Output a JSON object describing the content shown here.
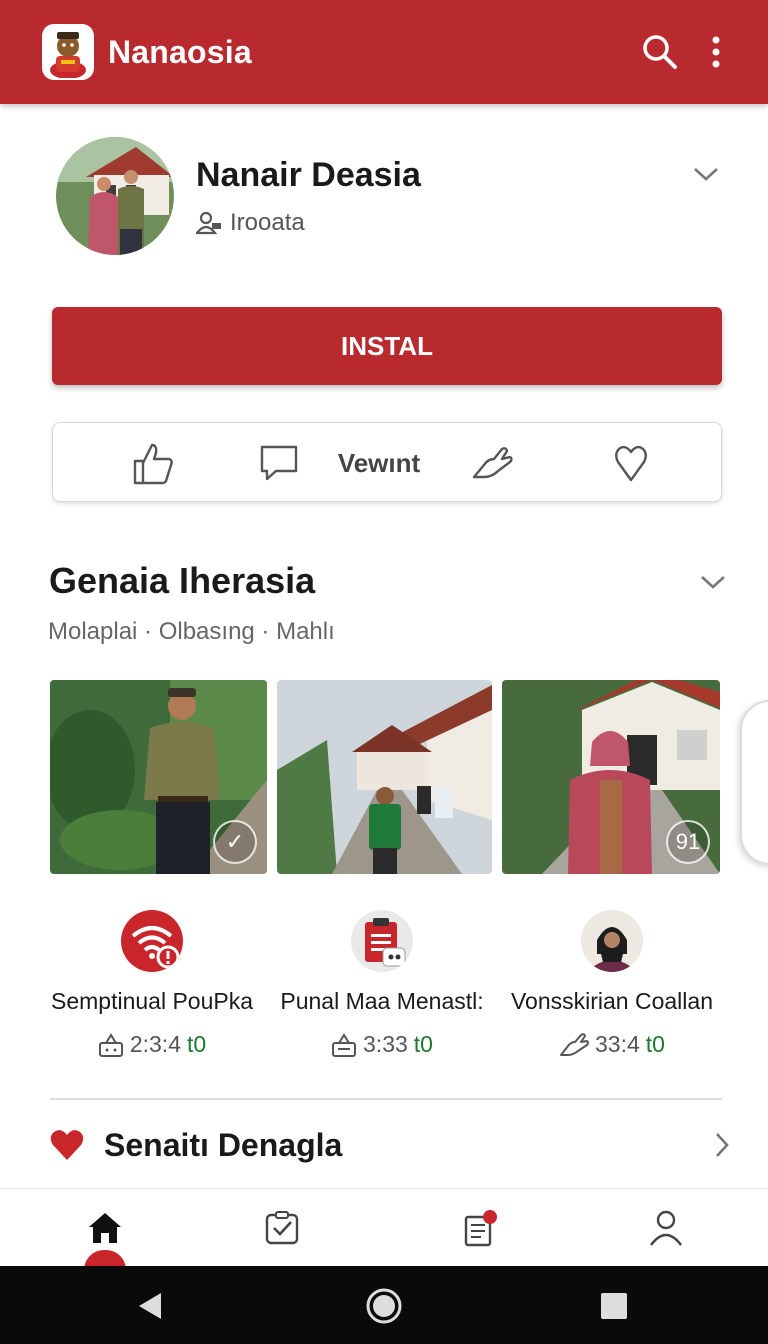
{
  "appbar": {
    "title": "Nanaosia",
    "logo_icon": "mascot-logo-icon",
    "search_icon": "search-icon",
    "menu_icon": "more-vertical-icon",
    "color": "#b82a2e"
  },
  "profile": {
    "name": "Nanair Deasia",
    "subtitle": "Irooata",
    "subtitle_icon": "user-group-icon"
  },
  "install": {
    "label": "INSTAL"
  },
  "actions": {
    "like_icon": "thumbs-up-icon",
    "comment_icon": "comment-icon",
    "view_label": "Vewınt",
    "share_icon": "share-hand-icon",
    "favorite_icon": "heart-outline-icon"
  },
  "section": {
    "title": "Genaia Iherasia",
    "meta": "Molaplai · Olbasıng · Mahlı"
  },
  "gallery": {
    "thumbs": [
      {
        "name": "thumb-man-garden",
        "badge": "✓"
      },
      {
        "name": "thumb-houses-path",
        "badge": ""
      },
      {
        "name": "thumb-woman-house",
        "badge": "91"
      }
    ]
  },
  "apps": [
    {
      "name": "Semptinual PouPka",
      "stats_prefix": "2:3:4",
      "stats_suffix": "t0",
      "stats_icon": "download-icon",
      "icon": "wifi-alert-icon"
    },
    {
      "name": "Punal Maa Menastl:",
      "stats_prefix": "3:33",
      "stats_suffix": "t0",
      "stats_icon": "download-icon",
      "icon": "clipboard-icon"
    },
    {
      "name": "Vonsskirian Coallan",
      "stats_prefix": "33:4",
      "stats_suffix": "t0",
      "stats_icon": "share-hand-icon",
      "icon": "woman-avatar-icon"
    }
  ],
  "favorites": {
    "title": "Senaitı Denagla",
    "icon": "heart-filled-icon"
  },
  "bottom_nav": [
    "home-icon",
    "checklist-icon",
    "notes-badge-icon",
    "profile-icon"
  ],
  "system_nav": [
    "back-icon",
    "home-circle-icon",
    "recents-icon"
  ]
}
